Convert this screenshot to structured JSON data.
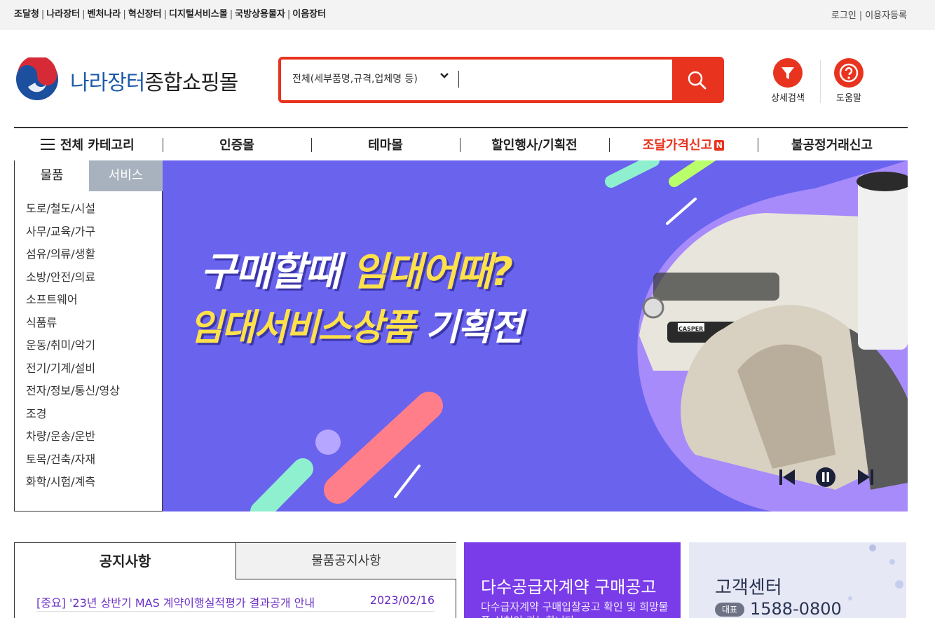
{
  "top_links": [
    "조달청",
    "나라장터",
    "벤처나라",
    "혁신장터",
    "디지털서비스몰",
    "국방상용물자",
    "이음장터"
  ],
  "top_right": {
    "login": "로그인",
    "register": "이용자등록"
  },
  "logo": {
    "part1": "나라장터",
    "part2": "종합쇼핑몰"
  },
  "search": {
    "scope": "전체(세부품명,규격,업체명 등)",
    "value": ""
  },
  "utils": {
    "detail_search": "상세검색",
    "help": "도움말"
  },
  "gnb": {
    "all_category": "전체 카테고리",
    "certified": "인증몰",
    "theme": "테마몰",
    "events": "할인행사/기획전",
    "price_report": "조달가격신고",
    "badge": "N",
    "unfair_report": "불공정거래신고"
  },
  "category": {
    "tab_goods": "물품",
    "tab_services": "서비스",
    "items": [
      "도로/철도/시설",
      "사무/교육/가구",
      "섬유/의류/생활",
      "소방/안전/의료",
      "소프트웨어",
      "식품류",
      "운동/취미/악기",
      "전기/기계/설비",
      "전자/정보/통신/영상",
      "조경",
      "차량/운송/운반",
      "토목/건축/자재",
      "화학/시험/계측"
    ]
  },
  "banner": {
    "line1_a": "구매할때 ",
    "line1_b": "임대어때?",
    "line2_a": "임대서비스상품",
    "line2_b": " 기획전",
    "car_badge": "CASPER"
  },
  "notice_board": {
    "tab_notice": "공지사항",
    "tab_goods_notice": "물품공지사항",
    "items": [
      {
        "title": "[중요] '23년 상반기 MAS 계약이행실적평가 결과공개 안내",
        "date": "2023/02/16"
      }
    ]
  },
  "mas": {
    "title": "다수공급자계약 구매공고",
    "desc": "다수급자계약 구매입찰공고 확인 및 희망물품 신청이 가능합니다"
  },
  "customer_center": {
    "title": "고객센터",
    "badge": "대표",
    "phone": "1588-0800"
  },
  "colors": {
    "accent": "#e8331e",
    "brand_blue": "#1c5aa8",
    "banner_bg": "#6a63ee",
    "banner_yellow": "#ffe14a",
    "notice_purple": "#6a2fc4"
  }
}
